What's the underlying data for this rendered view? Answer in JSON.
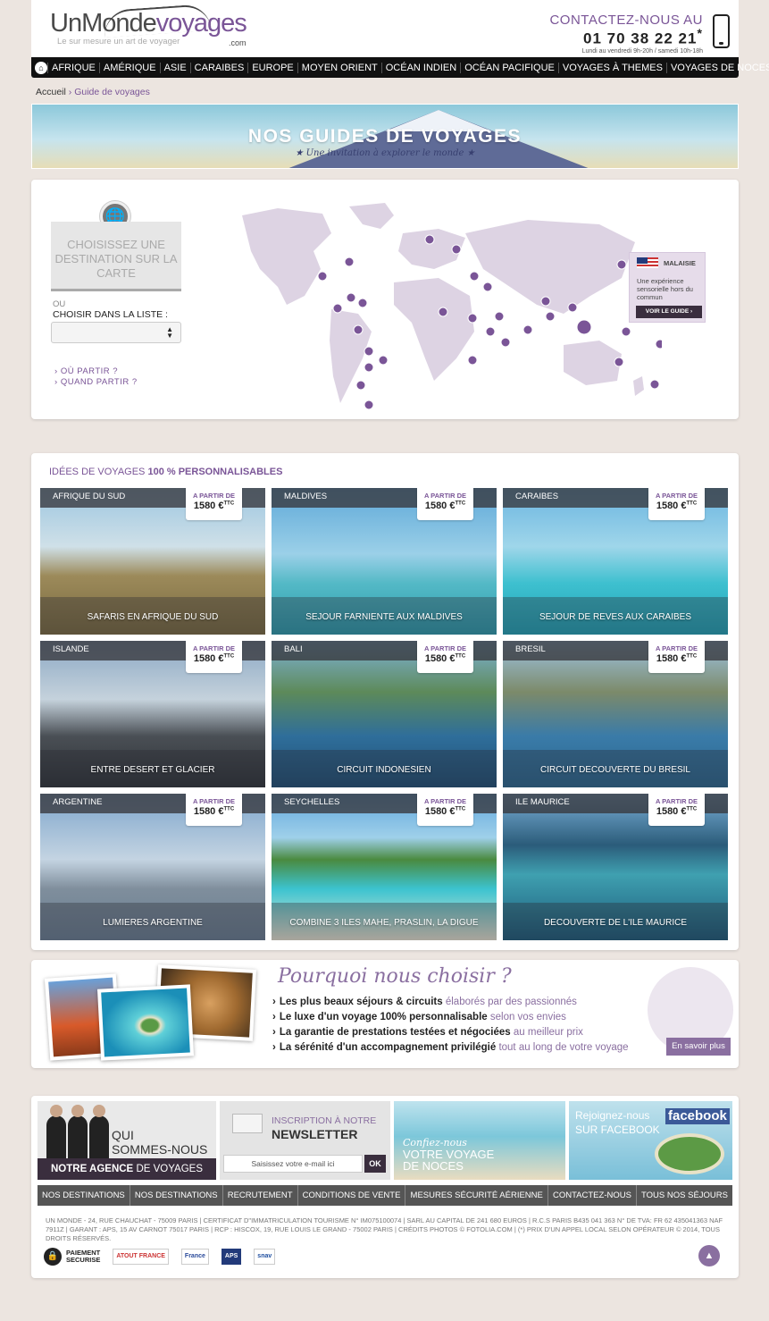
{
  "header": {
    "logo_part1": "UnMonde",
    "logo_part2": "voyages",
    "logo_tagline": "Le sur mesure un art de voyager",
    "logo_tld": ".com",
    "contact_title": "CONTACTEZ-NOUS AU",
    "contact_number": "01 70 38 22 21",
    "contact_star": "*",
    "contact_hours": "Lundi au vendredi 9h-20h / samedi 10h-18h"
  },
  "nav": {
    "items": [
      "AFRIQUE",
      "AMÉRIQUE",
      "ASIE",
      "CARAIBES",
      "EUROPE",
      "MOYEN ORIENT",
      "OCÉAN INDIEN",
      "OCÉAN PACIFIQUE",
      "VOYAGES À THEMES",
      "VOYAGES DE NOCES"
    ]
  },
  "breadcrumb": {
    "home": "Accueil",
    "separator": "›",
    "current": "Guide de voyages"
  },
  "banner": {
    "title": "NOS GUIDES DE VOYAGES",
    "subtitle": "★ Une invitation à explorer le monde ★"
  },
  "map_panel": {
    "choose_title": "CHOISISSEZ UNE DESTINATION SUR LA CARTE",
    "or": "OU",
    "list_label": "CHOISIR DANS LA LISTE :",
    "link_where": "OÙ PARTIR ?",
    "link_when": "QUAND PARTIR ?",
    "callout": {
      "country": "MALAISIE",
      "text": "Une expérience sensorielle hors du commun",
      "button": "VOIR LE GUIDE"
    }
  },
  "ideas": {
    "title_light": "IDÉES DE VOYAGES",
    "title_bold": "100 % PERSONNALISABLES",
    "price_from": "A PARTIR DE",
    "tiles": [
      {
        "country": "AFRIQUE DU SUD",
        "price": "1580 €",
        "ttc": "TTC",
        "name": "SAFARIS EN AFRIQUE DU SUD"
      },
      {
        "country": "MALDIVES",
        "price": "1580 €",
        "ttc": "TTC",
        "name": "SEJOUR FARNIENTE AUX MALDIVES"
      },
      {
        "country": "CARAIBES",
        "price": "1580 €",
        "ttc": "TTC",
        "name": "SEJOUR DE REVES AUX CARAIBES"
      },
      {
        "country": "ISLANDE",
        "price": "1580 €",
        "ttc": "TTC",
        "name": "ENTRE DESERT ET GLACIER"
      },
      {
        "country": "BALI",
        "price": "1580 €",
        "ttc": "TTC",
        "name": "CIRCUIT INDONESIEN"
      },
      {
        "country": "BRESIL",
        "price": "1580 €",
        "ttc": "TTC",
        "name": "CIRCUIT DECOUVERTE DU BRESIL"
      },
      {
        "country": "ARGENTINE",
        "price": "1580 €",
        "ttc": "TTC",
        "name": "LUMIERES ARGENTINE"
      },
      {
        "country": "SEYCHELLES",
        "price": "1580 €",
        "ttc": "TTC",
        "name": "COMBINE 3 ILES MAHE, PRASLIN, LA DIGUE"
      },
      {
        "country": "ILE MAURICE",
        "price": "1580 €",
        "ttc": "TTC",
        "name": "DECOUVERTE DE L'ILE MAURICE"
      }
    ]
  },
  "why": {
    "title": "Pourquoi nous choisir ?",
    "arrow": "›",
    "items": [
      {
        "bold": "Les plus beaux séjours & circuits",
        "light": "élaborés par des passionnés"
      },
      {
        "bold": "Le luxe d'un voyage 100% personnalisable",
        "light": "selon vos envies"
      },
      {
        "bold": "La garantie de prestations testées et négociées",
        "light": "au meilleur prix"
      },
      {
        "bold": "La sérénité d'un accompagnement privilégié",
        "light": "tout au long de votre voyage"
      }
    ],
    "button": "En savoir plus"
  },
  "footer": {
    "about_line1": "QUI",
    "about_line2": "SOMMES-NOUS ?",
    "agency_bold": "NOTRE AGENCE",
    "agency_light": "DE VOYAGES",
    "newsletter_line1": "INSCRIPTION À NOTRE",
    "newsletter_line2": "NEWSLETTER",
    "newsletter_placeholder": "Saisissez votre e-mail ici",
    "newsletter_ok": "OK",
    "honeymoon_line1": "Confiez-nous",
    "honeymoon_line2": "VOTRE VOYAGE DE NOCES",
    "facebook_line1": "Rejoignez-nous",
    "facebook_line2": "SUR FACEBOOK",
    "facebook_brand": "facebook",
    "nav": [
      "NOS DESTINATIONS",
      "NOS DESTINATIONS",
      "RECRUTEMENT",
      "CONDITIONS DE VENTE",
      "MESURES SÉCURITÉ AÉRIENNE",
      "CONTACTEZ-NOUS",
      "TOUS NOS SÉJOURS"
    ],
    "legal": "UN MONDE - 24, RUE CHAUCHAT - 75009 PARIS | CERTIFICAT D\"IMMATRICULATION TOURISME N° IM075100074 | SARL AU CAPITAL DE 241 680 EUROS | R.C.S PARIS B435 041 363 N° DE TVA: FR 62 435041363 NAF 7911Z | GARANT : APS, 15 AV CARNOT 75017 PARIS | RCP : HISCOX, 19, RUE LOUIS LE GRAND - 75002 PARIS | CRÉDITS PHOTOS © FOTOLIA.COM | (*) PRIX D'UN APPEL LOCAL SELON OPÉRATEUR © 2014, TOUS DROITS RÉSERVÉS.",
    "secure_line1": "PAIEMENT",
    "secure_line2": "SECURISE",
    "badges": [
      "ATOUT FRANCE",
      "France",
      "APS",
      "snav"
    ]
  },
  "colors": {
    "accent": "#7a5597",
    "dark": "#3a2e3e",
    "nav_bg": "#111111",
    "pin": "#7a5597"
  }
}
